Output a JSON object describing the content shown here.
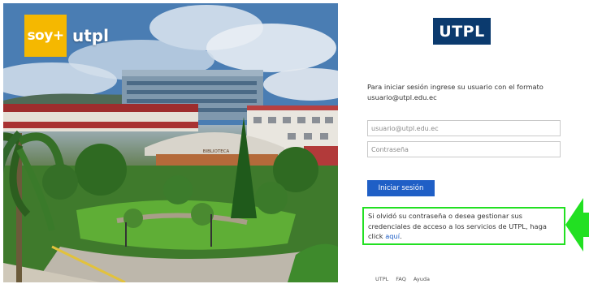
{
  "hero": {
    "brand_soy": "soy+",
    "brand_name": "utpl",
    "building_sign": "BIBLIOTECA"
  },
  "panel": {
    "logo_text": "UTPL",
    "intro_text": "Para iniciar sesión ingrese su usuario con el formato usuario@utpl.edu.ec",
    "username": {
      "value": "",
      "placeholder": "usuario@utpl.edu.ec"
    },
    "password": {
      "value": "",
      "placeholder": "Contraseña"
    },
    "login_button": "Iniciar sesión",
    "help_text": "Si olvidó su contraseña o desea gestionar sus credenciales de acceso a los servicios de UTPL, haga click ",
    "help_link": "aquí",
    "help_end": "."
  },
  "footer": {
    "links": [
      "UTPL",
      "FAQ",
      "Ayuda"
    ]
  },
  "annotation": {
    "highlight_color": "#22e022",
    "arrow_icon": "left-arrow-icon"
  },
  "colors": {
    "brand_blue": "#0b3a6e",
    "button_blue": "#1f5fc6",
    "brand_yellow": "#f5b800"
  }
}
